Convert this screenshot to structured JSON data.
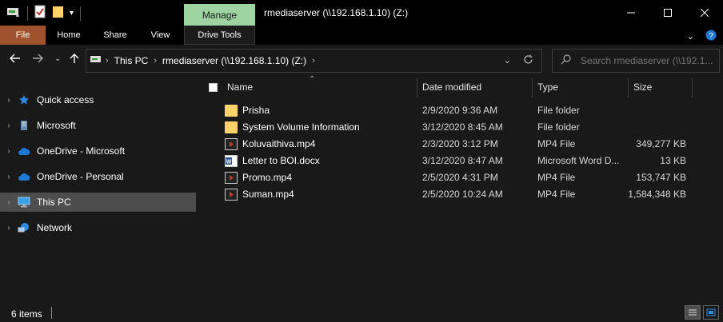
{
  "titlebar": {
    "manage_label": "Manage",
    "window_title": "rmediaserver (\\\\192.168.1.10) (Z:)"
  },
  "ribbon": {
    "tabs": [
      "File",
      "Home",
      "Share",
      "View",
      "Drive Tools"
    ],
    "file_color": "#a0522d",
    "manage_color": "#9ed4a1"
  },
  "address": {
    "crumbs": [
      "This PC",
      "rmediaserver (\\\\192.168.1.10) (Z:)"
    ],
    "search_placeholder": "Search rmediaserver (\\\\192.1..."
  },
  "sidebar": {
    "items": [
      {
        "label": "Quick access",
        "icon": "star-icon"
      },
      {
        "label": "Microsoft",
        "icon": "building-icon"
      },
      {
        "label": "OneDrive - Microsoft",
        "icon": "cloud-icon"
      },
      {
        "label": "OneDrive - Personal",
        "icon": "cloud-icon"
      },
      {
        "label": "This PC",
        "icon": "computer-icon"
      },
      {
        "label": "Network",
        "icon": "network-icon"
      }
    ],
    "selected": "This PC"
  },
  "columns": {
    "name": "Name",
    "date": "Date modified",
    "type": "Type",
    "size": "Size"
  },
  "files": [
    {
      "name": "Prisha",
      "date": "2/9/2020 9:36 AM",
      "type": "File folder",
      "size": "",
      "icon": "folder-icon"
    },
    {
      "name": "System Volume Information",
      "date": "3/12/2020 8:45 AM",
      "type": "File folder",
      "size": "",
      "icon": "folder-icon"
    },
    {
      "name": "Koluvaithiva.mp4",
      "date": "2/3/2020 3:12 PM",
      "type": "MP4 File",
      "size": "349,277 KB",
      "icon": "video-file-icon"
    },
    {
      "name": "Letter to BOI.docx",
      "date": "3/12/2020 8:47 AM",
      "type": "Microsoft Word D...",
      "size": "13 KB",
      "icon": "word-file-icon"
    },
    {
      "name": "Promo.mp4",
      "date": "2/5/2020 4:31 PM",
      "type": "MP4 File",
      "size": "153,747 KB",
      "icon": "video-file-icon"
    },
    {
      "name": "Suman.mp4",
      "date": "2/5/2020 10:24 AM",
      "type": "MP4 File",
      "size": "1,584,348 KB",
      "icon": "video-file-icon"
    }
  ],
  "status": {
    "item_count": "6 items"
  }
}
